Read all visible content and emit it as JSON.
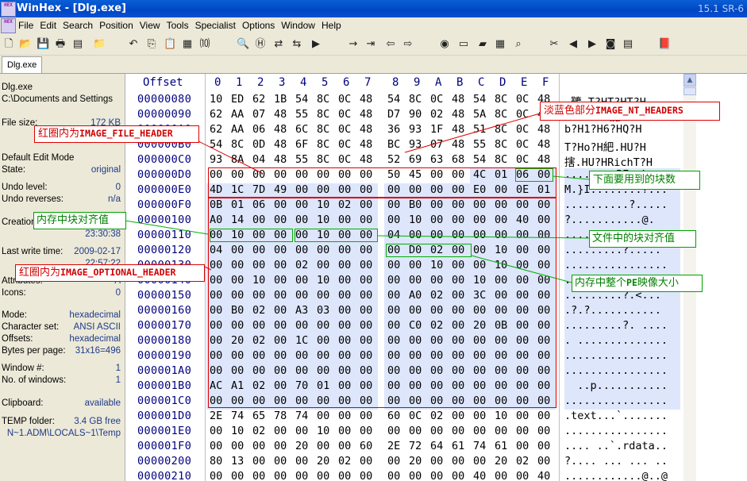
{
  "window": {
    "title": "WinHex - [Dlg.exe]",
    "version": "15.1 SR-6",
    "logo_text": "HEX"
  },
  "menu": [
    "File",
    "Edit",
    "Search",
    "Position",
    "View",
    "Tools",
    "Specialist",
    "Options",
    "Window",
    "Help"
  ],
  "toolbar": {
    "icons": [
      "new-icon",
      "open-icon",
      "save-icon",
      "print-icon",
      "properties-icon",
      "open-folder-icon",
      "undo-icon",
      "copy-icon",
      "paste-icon",
      "paste-special-icon",
      "hex-write-icon",
      "find-icon",
      "find-hex-icon",
      "replace-icon",
      "replace-hex-icon",
      "find-next-icon",
      "goto-icon",
      "goto-offset-icon",
      "back-icon",
      "forward-icon",
      "disk-icon",
      "ram-icon",
      "drive-icon",
      "calculator-icon",
      "magnifier-icon",
      "cut-tool-icon",
      "prev-icon",
      "next-icon",
      "camera-icon",
      "table-icon",
      "book-icon"
    ]
  },
  "tab": {
    "label": "Dlg.exe"
  },
  "info": {
    "filename": "Dlg.exe",
    "path": "C:\\Documents and Settings",
    "file_size_label": "File size:",
    "file_size": "172 KB",
    "edit_mode_label": "Default Edit Mode",
    "state_label": "State:",
    "state": "original",
    "undo_level_label": "Undo level:",
    "undo_level": "0",
    "undo_reverses_label": "Undo reverses:",
    "undo_reverses": "n/a",
    "creation_label": "Creation",
    "creation_time": "23:30:38",
    "last_write_label": "Last write time:",
    "last_write_date": "2009-02-17",
    "last_write_time": "22:57:22",
    "attributes_label": "Attributes:",
    "attributes": "A",
    "icons_label": "Icons:",
    "icons": "0",
    "mode_label": "Mode:",
    "mode": "hexadecimal",
    "charset_label": "Character set:",
    "charset": "ANSI ASCII",
    "offsets_label": "Offsets:",
    "offsets": "hexadecimal",
    "bpp_label": "Bytes per page:",
    "bpp": "31x16=496",
    "window_no_label": "Window #:",
    "window_no": "1",
    "num_windows_label": "No. of windows:",
    "num_windows": "1",
    "clipboard_label": "Clipboard:",
    "clipboard": "available",
    "temp_label": "TEMP folder:",
    "temp_free": "3.4 GB free",
    "temp_path": "N~1.ADM\\LOCALS~1\\Temp"
  },
  "editor": {
    "offset_header": "Offset",
    "column_headers": [
      "0",
      "1",
      "2",
      "3",
      "4",
      "5",
      "6",
      "7",
      "8",
      "9",
      "A",
      "B",
      "C",
      "D",
      "E",
      "F"
    ],
    "rows": [
      {
        "offset": "00000080",
        "bytes": [
          "10",
          "ED",
          "62",
          "1B",
          "54",
          "8C",
          "0C",
          "48",
          "54",
          "8C",
          "0C",
          "48",
          "54",
          "8C",
          "0C",
          "48"
        ],
        "ascii": ".韀.T?HT?HT?H"
      },
      {
        "offset": "00000090",
        "bytes": [
          "62",
          "AA",
          "07",
          "48",
          "55",
          "8C",
          "0C",
          "48",
          "D7",
          "90",
          "02",
          "48",
          "5A",
          "8C",
          "0C",
          "48"
        ],
        "ascii": "b?.HU?H讟.HZ?H"
      },
      {
        "offset": "000000A0",
        "bytes": [
          "62",
          "AA",
          "06",
          "48",
          "6C",
          "8C",
          "0C",
          "48",
          "36",
          "93",
          "1F",
          "48",
          "51",
          "8C",
          "0C",
          "48"
        ],
        "ascii": "b?H1?H6?HQ?H"
      },
      {
        "offset": "000000B0",
        "bytes": [
          "54",
          "8C",
          "0D",
          "48",
          "6F",
          "8C",
          "0C",
          "48",
          "BC",
          "93",
          "07",
          "48",
          "55",
          "8C",
          "0C",
          "48"
        ],
        "ascii": "T?Ho?H紦.HU?H"
      },
      {
        "offset": "000000C0",
        "bytes": [
          "93",
          "8A",
          "04",
          "48",
          "55",
          "8C",
          "0C",
          "48",
          "52",
          "69",
          "63",
          "68",
          "54",
          "8C",
          "0C",
          "48"
        ],
        "ascii": "搳.HU?HRichT?H"
      },
      {
        "offset": "000000D0",
        "bytes": [
          "00",
          "00",
          "00",
          "00",
          "00",
          "00",
          "00",
          "00",
          "50",
          "45",
          "00",
          "00",
          "4C",
          "01",
          "06",
          "00"
        ],
        "ascii": "........PE..L..."
      },
      {
        "offset": "000000E0",
        "bytes": [
          "4D",
          "1C",
          "7D",
          "49",
          "00",
          "00",
          "00",
          "00",
          "00",
          "00",
          "00",
          "00",
          "E0",
          "00",
          "0E",
          "01"
        ],
        "ascii": "M.}I........?..."
      },
      {
        "offset": "000000F0",
        "bytes": [
          "0B",
          "01",
          "06",
          "00",
          "00",
          "10",
          "02",
          "00",
          "00",
          "B0",
          "00",
          "00",
          "00",
          "00",
          "00",
          "00"
        ],
        "ascii": "..........?....."
      },
      {
        "offset": "00000100",
        "bytes": [
          "A0",
          "14",
          "00",
          "00",
          "00",
          "10",
          "00",
          "00",
          "00",
          "10",
          "00",
          "00",
          "00",
          "00",
          "40",
          "00"
        ],
        "ascii": "?...........@."
      },
      {
        "offset": "00000110",
        "bytes": [
          "00",
          "10",
          "00",
          "00",
          "00",
          "10",
          "00",
          "00",
          "04",
          "00",
          "00",
          "00",
          "00",
          "00",
          "00",
          "00"
        ],
        "ascii": "................"
      },
      {
        "offset": "00000120",
        "bytes": [
          "04",
          "00",
          "00",
          "00",
          "00",
          "00",
          "00",
          "00",
          "00",
          "D0",
          "02",
          "00",
          "00",
          "10",
          "00",
          "00"
        ],
        "ascii": ".........?....."
      },
      {
        "offset": "00000130",
        "bytes": [
          "00",
          "00",
          "00",
          "00",
          "02",
          "00",
          "00",
          "00",
          "00",
          "00",
          "10",
          "00",
          "00",
          "10",
          "00",
          "00"
        ],
        "ascii": "................"
      },
      {
        "offset": "00000140",
        "bytes": [
          "00",
          "00",
          "10",
          "00",
          "00",
          "10",
          "00",
          "00",
          "00",
          "00",
          "00",
          "00",
          "10",
          "00",
          "00",
          "00"
        ],
        "ascii": "................"
      },
      {
        "offset": "00000150",
        "bytes": [
          "00",
          "00",
          "00",
          "00",
          "00",
          "00",
          "00",
          "00",
          "00",
          "A0",
          "02",
          "00",
          "3C",
          "00",
          "00",
          "00"
        ],
        "ascii": ".........?.<..."
      },
      {
        "offset": "00000160",
        "bytes": [
          "00",
          "B0",
          "02",
          "00",
          "A3",
          "03",
          "00",
          "00",
          "00",
          "00",
          "00",
          "00",
          "00",
          "00",
          "00",
          "00"
        ],
        "ascii": ".?.?..........."
      },
      {
        "offset": "00000170",
        "bytes": [
          "00",
          "00",
          "00",
          "00",
          "00",
          "00",
          "00",
          "00",
          "00",
          "C0",
          "02",
          "00",
          "20",
          "0B",
          "00",
          "00"
        ],
        "ascii": ".........?. ...."
      },
      {
        "offset": "00000180",
        "bytes": [
          "00",
          "20",
          "02",
          "00",
          "1C",
          "00",
          "00",
          "00",
          "00",
          "00",
          "00",
          "00",
          "00",
          "00",
          "00",
          "00"
        ],
        "ascii": ". .............."
      },
      {
        "offset": "00000190",
        "bytes": [
          "00",
          "00",
          "00",
          "00",
          "00",
          "00",
          "00",
          "00",
          "00",
          "00",
          "00",
          "00",
          "00",
          "00",
          "00",
          "00"
        ],
        "ascii": "................"
      },
      {
        "offset": "000001A0",
        "bytes": [
          "00",
          "00",
          "00",
          "00",
          "00",
          "00",
          "00",
          "00",
          "00",
          "00",
          "00",
          "00",
          "00",
          "00",
          "00",
          "00"
        ],
        "ascii": "................"
      },
      {
        "offset": "000001B0",
        "bytes": [
          "AC",
          "A1",
          "02",
          "00",
          "70",
          "01",
          "00",
          "00",
          "00",
          "00",
          "00",
          "00",
          "00",
          "00",
          "00",
          "00"
        ],
        "ascii": "  ..p..........."
      },
      {
        "offset": "000001C0",
        "bytes": [
          "00",
          "00",
          "00",
          "00",
          "00",
          "00",
          "00",
          "00",
          "00",
          "00",
          "00",
          "00",
          "00",
          "00",
          "00",
          "00"
        ],
        "ascii": "................"
      },
      {
        "offset": "000001D0",
        "bytes": [
          "2E",
          "74",
          "65",
          "78",
          "74",
          "00",
          "00",
          "00",
          "60",
          "0C",
          "02",
          "00",
          "00",
          "10",
          "00",
          "00"
        ],
        "ascii": ".text...`......."
      },
      {
        "offset": "000001E0",
        "bytes": [
          "00",
          "10",
          "02",
          "00",
          "00",
          "10",
          "00",
          "00",
          "00",
          "00",
          "00",
          "00",
          "00",
          "00",
          "00",
          "00"
        ],
        "ascii": "................"
      },
      {
        "offset": "000001F0",
        "bytes": [
          "00",
          "00",
          "00",
          "00",
          "20",
          "00",
          "00",
          "60",
          "2E",
          "72",
          "64",
          "61",
          "74",
          "61",
          "00",
          "00"
        ],
        "ascii": ".... ..`.rdata.."
      },
      {
        "offset": "00000200",
        "bytes": [
          "80",
          "13",
          "00",
          "00",
          "00",
          "20",
          "02",
          "00",
          "00",
          "20",
          "00",
          "00",
          "00",
          "20",
          "02",
          "00"
        ],
        "ascii": "?.... ... ... .."
      },
      {
        "offset": "00000210",
        "bytes": [
          "00",
          "00",
          "00",
          "00",
          "00",
          "00",
          "00",
          "00",
          "00",
          "00",
          "00",
          "00",
          "40",
          "00",
          "00",
          "40"
        ],
        "ascii": "............@..@"
      }
    ]
  },
  "annotations": {
    "nt_headers": {
      "prefix": "淡蓝色部分",
      "name": "IMAGE_NT_HEADERS"
    },
    "file_header": {
      "prefix": "红圈内为",
      "name": "IMAGE_FILE_HEADER"
    },
    "optional_header": {
      "prefix": "红圈内为",
      "name": "IMAGE_OPTIONAL_HEADER"
    },
    "section_count": "下面要用到的块数",
    "mem_align": "内存中块对齐值",
    "file_align": "文件中的块对齐值",
    "image_size_prefix": "内存中整个",
    "image_size_pe": "PE",
    "image_size_suffix": "映像大小"
  },
  "colors": {
    "title_blue": "#0046c4",
    "nt_highlight": "#dde6fb",
    "annotation_red": "#e00000",
    "annotation_green": "#00b000",
    "offset_text": "#000080"
  }
}
